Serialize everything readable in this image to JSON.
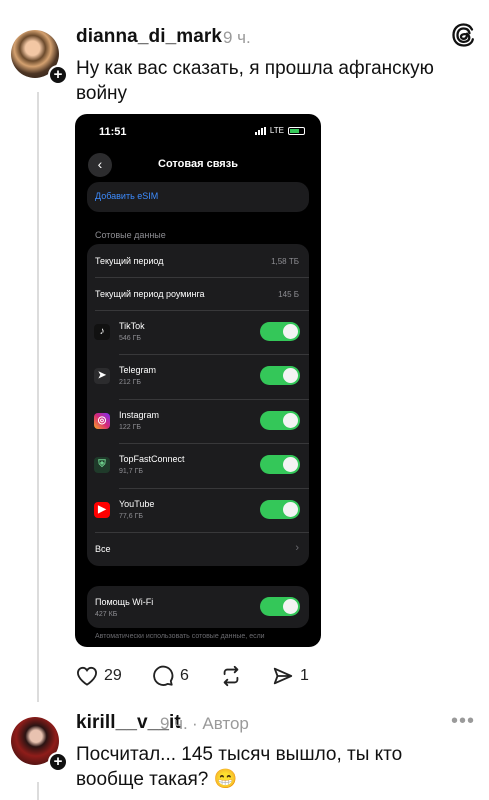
{
  "post": {
    "username": "dianna_di_mark",
    "time": "9 ч.",
    "text": "Ну как вас сказать, я прошла афганскую войну",
    "likes": "29",
    "comments": "6",
    "shares": "1"
  },
  "phone": {
    "status_time": "11:51",
    "network": "LTE",
    "title": "Сотовая связь",
    "esim_link": "Добавить eSIM",
    "section_label": "Сотовые данные",
    "current_period_label": "Текущий период",
    "current_period_value": "1,58 ТБ",
    "roaming_label": "Текущий период роуминга",
    "roaming_value": "145 Б",
    "apps": [
      {
        "name": "TikTok",
        "size": "546 ГБ",
        "icon": "tiktok-icon",
        "color": "#111111"
      },
      {
        "name": "Telegram",
        "size": "212 ГБ",
        "icon": "telegram-icon",
        "color": "#2c2c2e"
      },
      {
        "name": "Instagram",
        "size": "122 ГБ",
        "icon": "instagram-icon",
        "color": "#d62976"
      },
      {
        "name": "TopFastConnect",
        "size": "91,7 ГБ",
        "icon": "shield-icon",
        "color": "#1f3a2a"
      },
      {
        "name": "YouTube",
        "size": "77,6 ГБ",
        "icon": "youtube-icon",
        "color": "#ff0000"
      }
    ],
    "all_label": "Все",
    "wifi_assist_label": "Помощь Wi-Fi",
    "wifi_assist_value": "427 КБ",
    "footer": "Автоматически использовать сотовые данные, если"
  },
  "reply": {
    "username": "kirill__v__it",
    "time": "9 ч.",
    "author_badge": "· Автор",
    "text_line1": "Посчитал... 145 тысяч вышло, ты кто",
    "text_line2": "вообще такая? 😁"
  },
  "colors": {
    "toggle_on": "#34c759",
    "link_blue": "#3d8bfd",
    "meta_gray": "#9a9a9a"
  }
}
